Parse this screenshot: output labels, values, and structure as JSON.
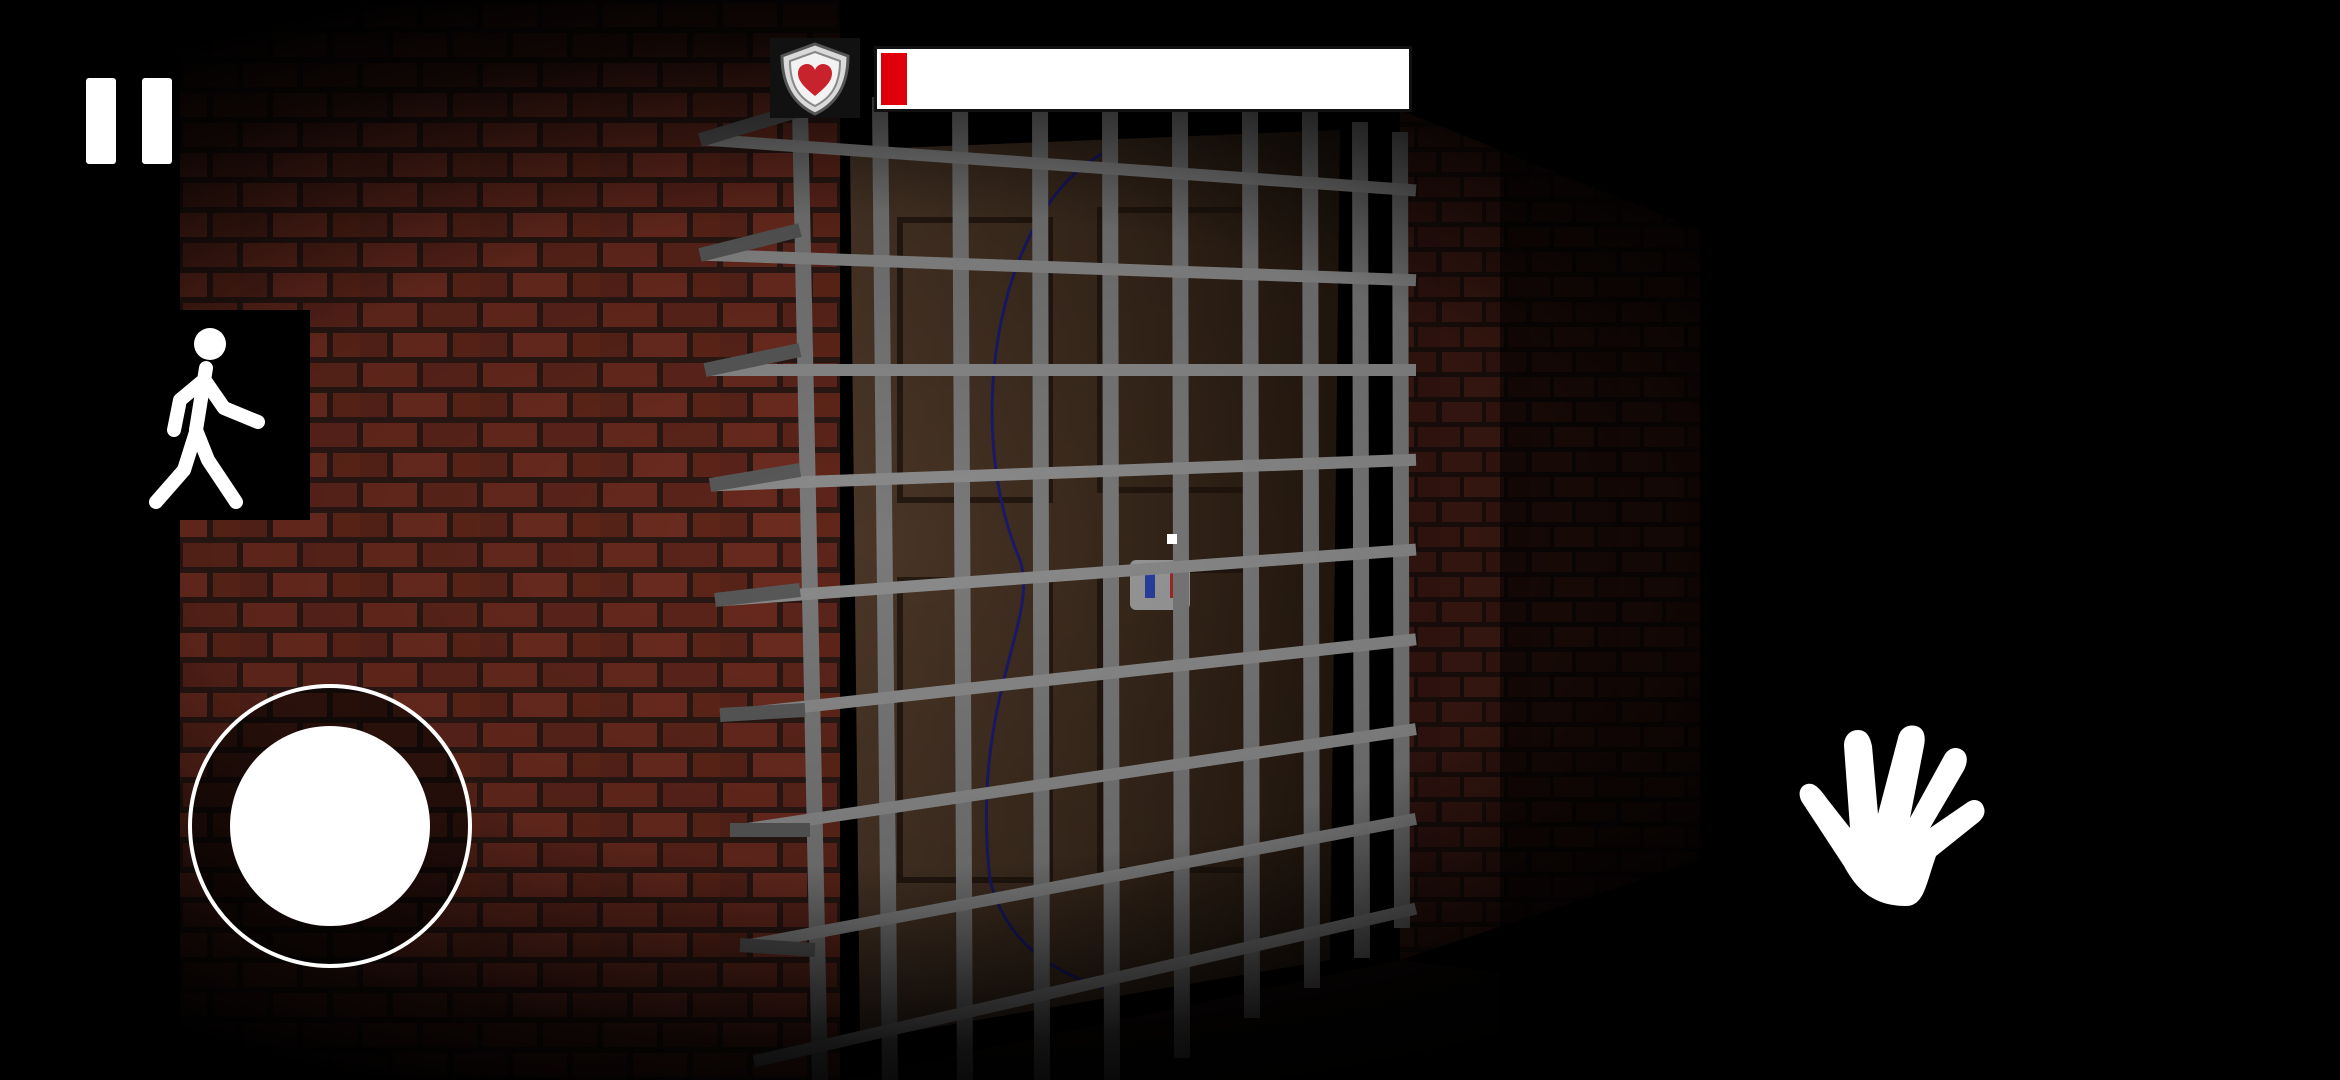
{
  "game": {
    "scene": "dark-cellar-with-caged-door"
  },
  "hud": {
    "pause_icon": "pause-icon",
    "walk_icon": "walking-person-icon",
    "interact_icon": "hand-icon",
    "health": {
      "icon": "shield-heart-icon",
      "fill_fraction": 0.05,
      "fill_color": "#e0000a",
      "empty_color": "#ffffff"
    },
    "joystick": {
      "icon": "joystick"
    }
  },
  "colors": {
    "brick": "#5a231a",
    "mortar": "#2a1b16",
    "bars": "#8c8c8c",
    "door": "#3e2c1f"
  }
}
